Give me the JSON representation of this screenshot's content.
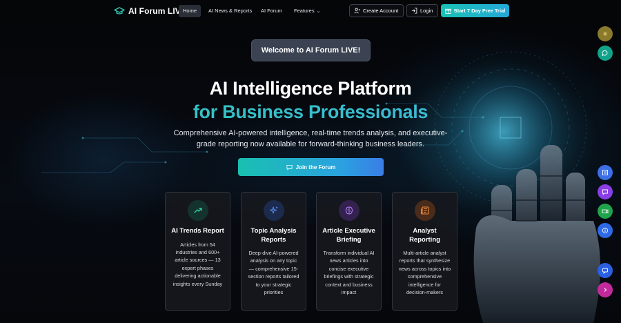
{
  "brand": {
    "name": "AI Forum LIVE",
    "logo_icon": "graduation-cap-icon"
  },
  "nav": {
    "links": [
      {
        "label": "Home",
        "active": true
      },
      {
        "label": "AI News & Reports"
      },
      {
        "label": "AI Forum"
      },
      {
        "label": "Features",
        "has_dropdown": true
      }
    ],
    "create_account": "Create Account",
    "login": "Login",
    "trial": "Start 7 Day Free Trial"
  },
  "hero": {
    "welcome": "Welcome to AI Forum LIVE!",
    "title_line1": "AI Intelligence Platform",
    "title_line2": "for Business Professionals",
    "subtitle": "Comprehensive AI-powered intelligence, real-time trends analysis, and executive-grade reporting now available for forward-thinking business leaders.",
    "cta": "Join the Forum"
  },
  "cards": [
    {
      "title": "AI Trends Report",
      "description": "Articles from 54 industries and 600+ article sources — 13 expert phases delivering actionable insights every Sunday",
      "icon": "trending-up-icon",
      "accent": "#2fc7a0"
    },
    {
      "title": "Topic Analysis Reports",
      "description": "Deep-dive AI-powered analysis on any topic — comprehensive 15-section reports tailored to your strategic priorities",
      "icon": "sparkles-icon",
      "accent": "#5a8cf0"
    },
    {
      "title": "Article Executive Briefing",
      "description": "Transform individual AI news articles into concise executive briefings with strategic context and business impact",
      "icon": "brain-icon",
      "accent": "#b07cf2"
    },
    {
      "title": "Analyst Reporting",
      "description": "Multi-article analyst reports that synthesize news across topics into comprehensive intelligence for decision-makers",
      "icon": "newspaper-icon",
      "accent": "#f08a3c"
    }
  ],
  "side_buttons": [
    {
      "name": "avatar-button",
      "color": "#8a7a2c"
    },
    {
      "name": "chat-button",
      "color": "#12a38b"
    },
    {
      "name": "reports-button",
      "color": "#3b6fe6"
    },
    {
      "name": "message-button",
      "color": "#8a3ee6"
    },
    {
      "name": "video-button",
      "color": "#1fa34b"
    },
    {
      "name": "info-button",
      "color": "#2e6ae8"
    },
    {
      "name": "feedback-button",
      "color": "#2a5fe2"
    },
    {
      "name": "expand-button",
      "color": "#c22a9c"
    }
  ]
}
